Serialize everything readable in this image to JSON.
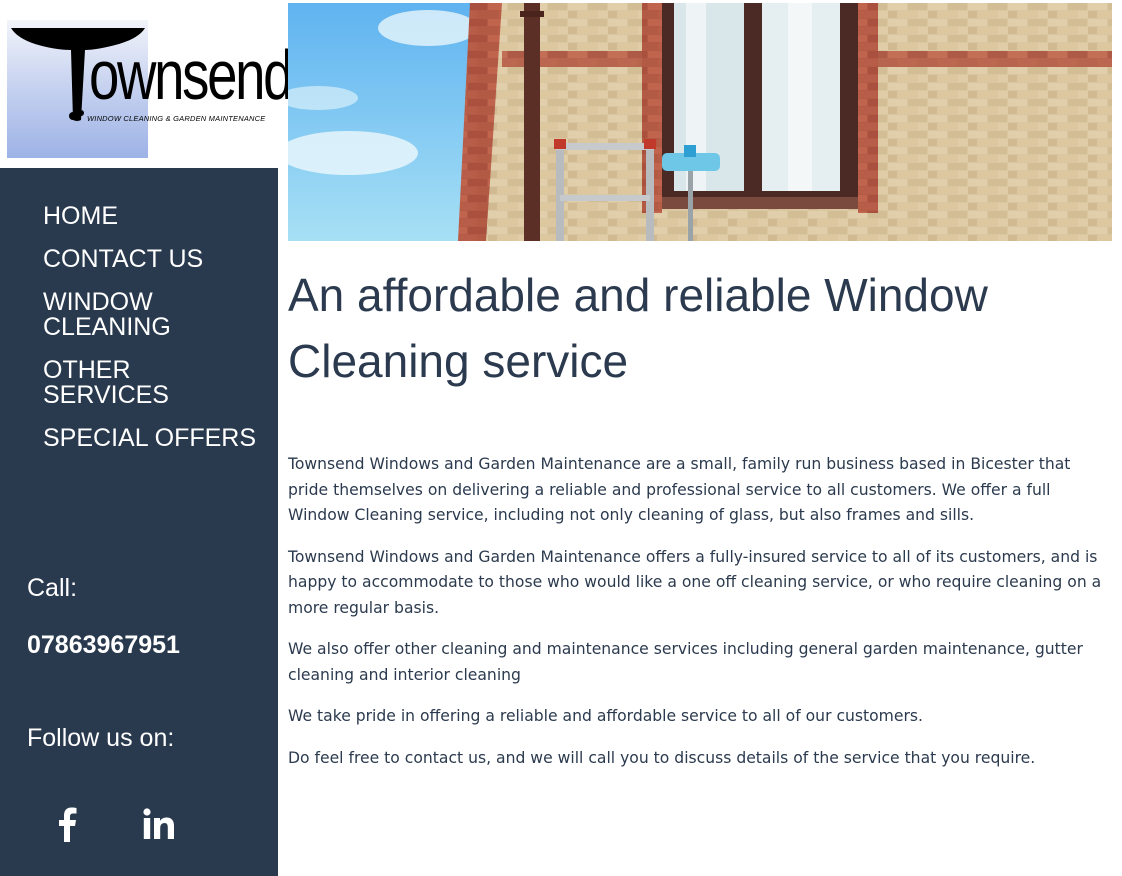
{
  "logo": {
    "wordmark": "ownsend",
    "tagline": "WINDOW CLEANING & GARDEN MAINTENANCE"
  },
  "nav": [
    {
      "label": "HOME"
    },
    {
      "label": "CONTACT US"
    },
    {
      "label": "WINDOW CLEANING"
    },
    {
      "label": "OTHER SERVICES"
    },
    {
      "label": "SPECIAL OFFERS"
    }
  ],
  "contact": {
    "call_label": "Call:",
    "phone": "07863967951",
    "follow_label": "Follow us on:"
  },
  "social": [
    {
      "icon": "facebook-icon"
    },
    {
      "icon": "linkedin-icon"
    }
  ],
  "main": {
    "headline": "An affordable and reliable Window Cleaning service",
    "paragraphs": [
      "Townsend Windows and Garden Maintenance are a small, family run business based in Bicester that pride themselves on delivering a reliable and professional service to all customers. We offer a full Window Cleaning service, including not only cleaning of glass, but also frames and sills.",
      "Townsend Windows and Garden Maintenance offers a fully-insured service to all of its customers, and is happy to accommodate to those who would like a one off cleaning service, or who require cleaning on a more regular basis.",
      "We also offer other cleaning and maintenance services including general garden maintenance, gutter cleaning and interior cleaning",
      "We take pride in offering a reliable and affordable service to all of our customers.",
      "Do feel free to contact us, and we will call you to discuss details of the service that you require."
    ]
  },
  "colors": {
    "sidebar": "#2a3a4e",
    "text": "#2b3a4e",
    "nav_text": "#ffffff"
  }
}
